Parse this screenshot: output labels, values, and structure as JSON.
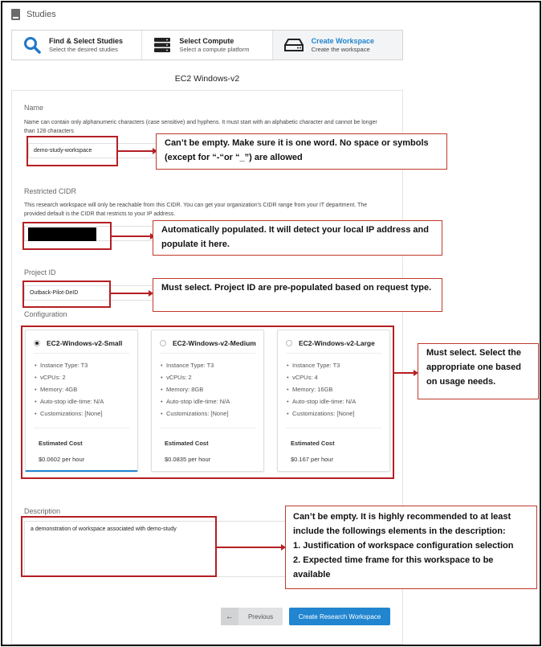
{
  "header": {
    "title": "Studies"
  },
  "wizard": {
    "steps": [
      {
        "title": "Find & Select Studies",
        "desc": "Select the desired studies"
      },
      {
        "title": "Select Compute",
        "desc": "Select a compute platform"
      },
      {
        "title": "Create Workspace",
        "desc": "Create the workspace"
      }
    ],
    "active_step": 2
  },
  "page_title": "EC2 Windows-v2",
  "name_section": {
    "label": "Name",
    "help": "Name can contain only alphanumeric characters (case sensitive) and hyphens. It must start with an alphabetic character and cannot be longer than 128 characters",
    "value": "demo-study-workspace"
  },
  "cidr_section": {
    "label": "Restricted CIDR",
    "help": "This research workspace will only be reachable from this CIDR. You can get your organization's CIDR range from your IT department. The provided default is the CIDR that restricts to your IP address."
  },
  "project_section": {
    "label": "Project ID",
    "value": "Outback-Pilot-DeID"
  },
  "configuration": {
    "label": "Configuration",
    "estimated_cost_label": "Estimated Cost",
    "cards": [
      {
        "name": "EC2-Windows-v2-Small",
        "selected": true,
        "specs": [
          "Instance Type: T3",
          "vCPUs: 2",
          "Memory: 4GB",
          "Auto-stop idle-time: N/A",
          "Customizations: [None]"
        ],
        "price": "$0.0602 per hour"
      },
      {
        "name": "EC2-Windows-v2-Medium",
        "selected": false,
        "specs": [
          "Instance Type: T3",
          "vCPUs: 2",
          "Memory: 8GB",
          "Auto-stop idle-time: N/A",
          "Customizations: [None]"
        ],
        "price": "$0.0835 per hour"
      },
      {
        "name": "EC2-Windows-v2-Large",
        "selected": false,
        "specs": [
          "Instance Type: T3",
          "vCPUs: 4",
          "Memory: 16GB",
          "Auto-stop idle-time: N/A",
          "Customizations: [None]"
        ],
        "price": "$0.167 per hour"
      }
    ]
  },
  "description_section": {
    "label": "Description",
    "value": "a demonstration of workspace associated with demo-study"
  },
  "buttons": {
    "previous": "Previous",
    "create": "Create Research Workspace"
  },
  "annotations": {
    "name": "Can’t be empty. Make sure it is one word. No space or symbols (except for “-“or “_”)  are allowed",
    "cidr": "Automatically populated. It will detect your local IP address and populate it here.",
    "project": "Must select. Project ID are pre-populated based on request type.",
    "config": "Must select. Select the appropriate one based on usage needs.",
    "desc_intro": "Can’t be empty. It is highly recommended to at least include the followings elements in the description:",
    "desc_item1": "1. Justification of workspace configuration selection",
    "desc_item2": "2. Expected time frame for this workspace to be available"
  },
  "colors": {
    "accent": "#2185d0",
    "annotation_red": "#b51f24"
  }
}
